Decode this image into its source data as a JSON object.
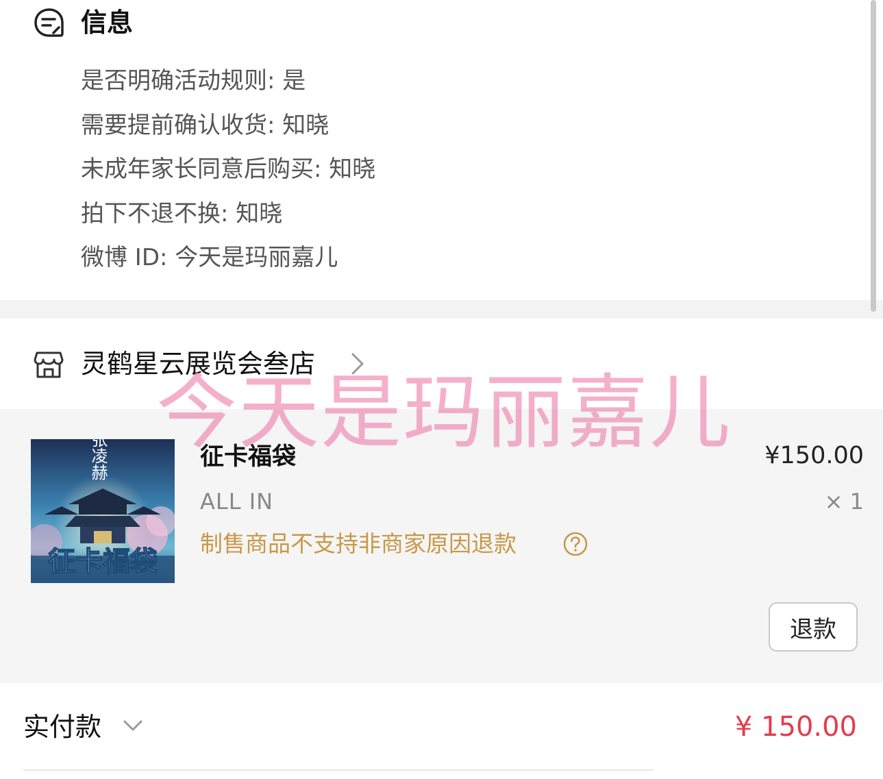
{
  "info": {
    "title": "信息",
    "rows": [
      "是否明确活动规则: 是",
      "需要提前确认收货: 知晓",
      "未成年家长同意后购买: 知晓",
      "拍下不退不换: 知晓",
      "微博 ID: 今天是玛丽嘉儿"
    ]
  },
  "store": {
    "name": "灵鹤星云展览会叁店"
  },
  "product": {
    "name": "征卡福袋",
    "price": "¥150.00",
    "variant": "ALL IN",
    "quantity": "× 1",
    "note": "制售商品不支持非商家原因退款",
    "refund_label": "退款",
    "thumbnail_text": "征卡福袋",
    "thumbnail_name": "张凌赫"
  },
  "payment": {
    "label": "实付款",
    "amount": "¥ 150.00"
  },
  "watermark": "今天是玛丽嘉儿",
  "colors": {
    "accent_price": "#e33c4f",
    "note_text": "#c89848",
    "watermark": "#ee80aa"
  }
}
